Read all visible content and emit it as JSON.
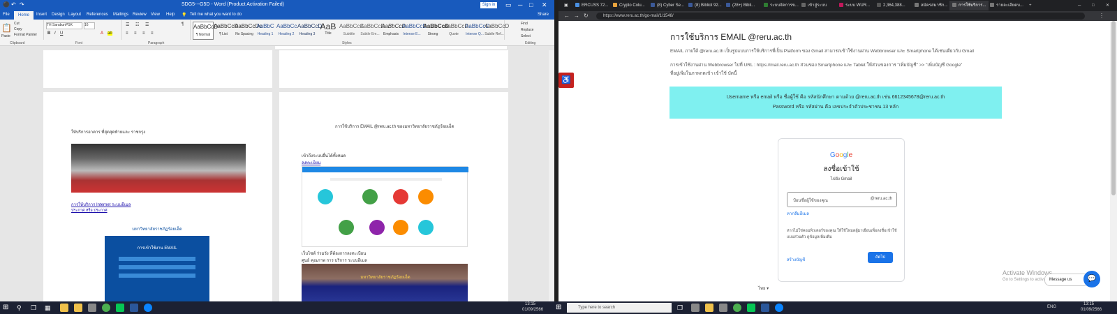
{
  "word": {
    "title": "SDG5---G5D - Word (Product Activation Failed)",
    "sign_in": "Sign in",
    "share": "Share",
    "menu": [
      "File",
      "Home",
      "Insert",
      "Design",
      "Layout",
      "References",
      "Mailings",
      "Review",
      "View",
      "Help",
      "Tell me what you want to do"
    ],
    "clipboard": {
      "paste": "Paste",
      "cut": "Cut",
      "copy": "Copy",
      "painter": "Format Painter",
      "label": "Clipboard"
    },
    "font": {
      "name": "TH SarabunPSK",
      "size": "16",
      "label": "Font"
    },
    "paragraph_label": "Paragraph",
    "styles": [
      {
        "sample": "AaBbCcD",
        "name": "¶ Normal"
      },
      {
        "sample": "AaBbCcD",
        "name": "¶ List"
      },
      {
        "sample": "AaBbCcDc",
        "name": "No Spacing"
      },
      {
        "sample": "AaBbC",
        "name": "Heading 1"
      },
      {
        "sample": "AaBbCc",
        "name": "Heading 2"
      },
      {
        "sample": "AaBbCcD",
        "name": "Heading 3"
      },
      {
        "sample": "AaB",
        "name": "Title"
      },
      {
        "sample": "AaBbCcC",
        "name": "Subtitle"
      },
      {
        "sample": "AaBbCcD",
        "name": "Subtle Em..."
      },
      {
        "sample": "AaBbCcD",
        "name": "Emphasis"
      },
      {
        "sample": "AaBbCcD",
        "name": "Intense E..."
      },
      {
        "sample": "AaBbCcD",
        "name": "Strong"
      },
      {
        "sample": "AaBbCcD",
        "name": "Quote"
      },
      {
        "sample": "AaBbCcD",
        "name": "Intense Q..."
      },
      {
        "sample": "AaBbCcD",
        "name": "Subtle Ref..."
      }
    ],
    "styles_label": "Styles",
    "editing": {
      "find": "Find",
      "replace": "Replace",
      "select": "Select",
      "label": "Editing"
    },
    "doc": {
      "left_caption": "ให้บริการอาคาร ที่สุดสุดท้ายและ ราชกรุง",
      "left_link": "การให้บริการ Internet ระบบอีเมล",
      "left_link_tail": "ประกาศ หรือ ประกาศ",
      "right_heading": "การใช้บริการ EMAIL @reru.ac.th ของมหาวิทยาลัยราชภัฏร้อยเอ็ด",
      "right_sub": "เข้าถึงระบบอื่นได้ทั้งหมด",
      "right_link": "ลงทะเบียน",
      "right_bottom1": "เว็บไซต์ ร่วมวัง ที่ต้องการลงทะเบียน",
      "right_bottom2": "ศูนย์ คุณภาพ การ บริการ ระบบอีเมล",
      "poster_title": "มหาวิทยาลัยราชภัฏร้อยเอ็ด",
      "poster_email": "การเข้าใช้งาน EMAIL",
      "sign_text": "มหาวิทยาลัยราชภัฏร้อยเอ็ด",
      "page_tiles": [
        "",
        "",
        "",
        "",
        "",
        "",
        "",
        ""
      ]
    }
  },
  "browser": {
    "tabs": [
      {
        "label": "ERCUSS 72...",
        "color": "#4a90e2"
      },
      {
        "label": "Crypto Colu...",
        "color": "#e8a33d"
      },
      {
        "label": "(8) Cyber Se...",
        "color": "#3b5998"
      },
      {
        "label": "(8) Bibliot 92...",
        "color": "#3b5998"
      },
      {
        "label": "(28+) Bibli...",
        "color": "#3b5998"
      },
      {
        "label": "ระบบจัดการข...",
        "color": "#2e7d32"
      },
      {
        "label": "เข้าสู่ระบบ",
        "color": "#666"
      },
      {
        "label": "ระบบ WUR...",
        "color": "#c2185b"
      },
      {
        "label": "2,364,388...",
        "color": "#555"
      },
      {
        "label": "สมัครสมาชิก...",
        "color": "#777"
      },
      {
        "label": "การใช้บริการ...",
        "color": "#777"
      },
      {
        "label": "รายละเอียดบ...",
        "color": "#777"
      }
    ],
    "url": "https://www.reru.ac.th/go-mail/1/1548/",
    "page": {
      "title": "การใช้บริการ EMAIL @reru.ac.th",
      "p1": "EMAIL ภายใต้ @reru.ac.th เป็นรูปแบบการให้บริการที่เป็น Platform ของ Gmail สามารถเข้าใช้งานผ่าน Webbrowser และ Smartphone ได้เช่นเดียวกับ Gmail",
      "p2": "การเข้าใช้งานผ่าน Webbrowser ไปที่ URL : https://mail.reru.ac.th ส่วนของ Smartphone และ Tablet ให้ส่วนของการ \"เพิ่มบัญชี\" >> \"เพิ่มบัญชี Google\"",
      "p3": "ที่อยู่เพิ่มในภาพกดเข้า เข้าใช้ บัดนี้",
      "cyan1": "Username หรือ email หรือ ชื่อผู้ใช้ คือ รหัสนักศึกษา ตามด้วย @reru.ac.th เช่น 6612345678@reru.ac.th",
      "cyan2": "Password หรือ รหัสผ่าน คือ เลขประจำตัวประชาชน 13 หลัก",
      "google": {
        "logo": [
          "G",
          "o",
          "o",
          "g",
          "l",
          "e"
        ],
        "title": "ลงชื่อเข้าใช้",
        "subtitle": "ไปยัง Gmail",
        "input_placeholder": "ป้อนชื่อผู้ใช้ของคุณ",
        "domain": "@reru.ac.th",
        "forgot": "หากลืมอีเมล",
        "note": "หากไม่ใช่คอมพิวเตอร์ของคุณ ให้ใช้โหมดผู้มาเยือนเพื่อลงชื่อเข้าใช้แบบส่วนตัว ดูข้อมูลเพิ่มเติม",
        "create": "สร้างบัญชี",
        "next": "ถัดไป",
        "lang": "ไทย"
      },
      "activate1": "Activate Windows",
      "activate2": "Go to Settings to activate Windows.",
      "message_us": "Message us"
    }
  },
  "taskbar": {
    "search": "Type here to search",
    "left_time": "13:15",
    "left_date": "01/09/2566",
    "right_time": "13:15",
    "right_date": "01/09/2566",
    "lang": "ENG"
  }
}
